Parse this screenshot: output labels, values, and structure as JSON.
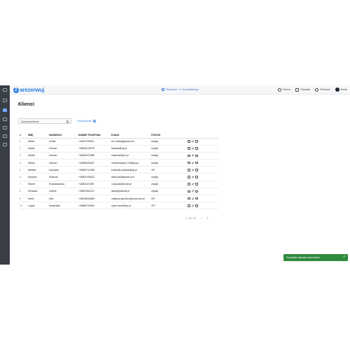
{
  "brand": {
    "logo_letter": "Z",
    "name": "arezerwuj"
  },
  "topbar": {
    "center_text": "Terminarz / Z. Koszalińskiego",
    "items": [
      {
        "label": "Pomoc",
        "icon": "help-icon"
      },
      {
        "label": "Tutoriale",
        "icon": "tutorial-icon"
      },
      {
        "label": "Premium",
        "icon": "premium-icon"
      },
      {
        "label": "Konto",
        "icon": "avatar"
      }
    ]
  },
  "sidebar": {
    "items": [
      {
        "icon": "menu-icon",
        "active": false
      },
      {
        "icon": "calendar-icon",
        "active": false
      },
      {
        "icon": "clients-icon",
        "active": true
      },
      {
        "icon": "list-icon",
        "active": false
      },
      {
        "icon": "services-icon",
        "active": false
      },
      {
        "icon": "stats-icon",
        "active": false
      },
      {
        "icon": "settings-icon",
        "active": false
      }
    ]
  },
  "page": {
    "title": "Klienci",
    "search_placeholder": "Wyszukaj klienta...",
    "add_label": "Dodaj klienta"
  },
  "table": {
    "headers": [
      "#",
      "IMIĘ",
      "NAZWISKO",
      "NUMER TELEFONU",
      "E-MAIL",
      "STATUS",
      ""
    ],
    "rows": [
      {
        "idx": "1",
        "first": "Wiktor",
        "last": "Ciołka",
        "phone": "+48457705621",
        "email": "w1.ciolka@gmail.com",
        "status": "zwykły"
      },
      {
        "idx": "2",
        "first": "Marcin",
        "last": "Karwan",
        "phone": "+48634219878",
        "email": "karwan@wp.pl",
        "status": "zwykły"
      },
      {
        "idx": "3",
        "first": "Marcin",
        "last": "Karwan",
        "phone": "+48634221985",
        "email": "mkarwan@o2.pl",
        "status": "zwykły"
      },
      {
        "idx": "4",
        "first": "Marcin",
        "last": "Karwan",
        "phone": "+48695225487",
        "email": "marcinkarwan.123@wp.pl",
        "status": "zwykły"
      },
      {
        "idx": "5",
        "first": "Martina",
        "last": "Kołodziej",
        "phone": "+48690714498",
        "email": "kolodziej.martina@wp.pl",
        "status": "VIP"
      },
      {
        "idx": "6",
        "first": "Karolina",
        "last": "Kiełczak",
        "phone": "+48504705632",
        "email": "kkielczak@gmail.com",
        "status": "zwykły"
      },
      {
        "idx": "7",
        "first": "Robert",
        "last": "Krzyształowicz",
        "phone": "+48504421987",
        "email": "r.krysztal2@onet.pl",
        "status": "zwykły"
      },
      {
        "idx": "8",
        "first": "Mirosław",
        "last": "Ławnik",
        "phone": "+48557654127",
        "email": "lawnik@lawnik.pl",
        "status": "zwykły"
      },
      {
        "idx": "9",
        "first": "Mario",
        "last": "Mes",
        "phone": "+48503543689",
        "email": "mateusz.jarewicz@meat.com.pl",
        "status": "VIP"
      },
      {
        "idx": "10",
        "first": "Lucjan",
        "last": "Mostowiak",
        "phone": "+48668719694",
        "email": "lucek.most@wp.pl",
        "status": "VIP"
      }
    ]
  },
  "pagination": {
    "text": "1 - 10 / 11"
  },
  "toast": {
    "text": "Pomyślnie zapisano dane klienta"
  },
  "colors": {
    "accent": "#2f7de1",
    "sidebar": "#3a3f47",
    "toast": "#2f8a3c"
  }
}
